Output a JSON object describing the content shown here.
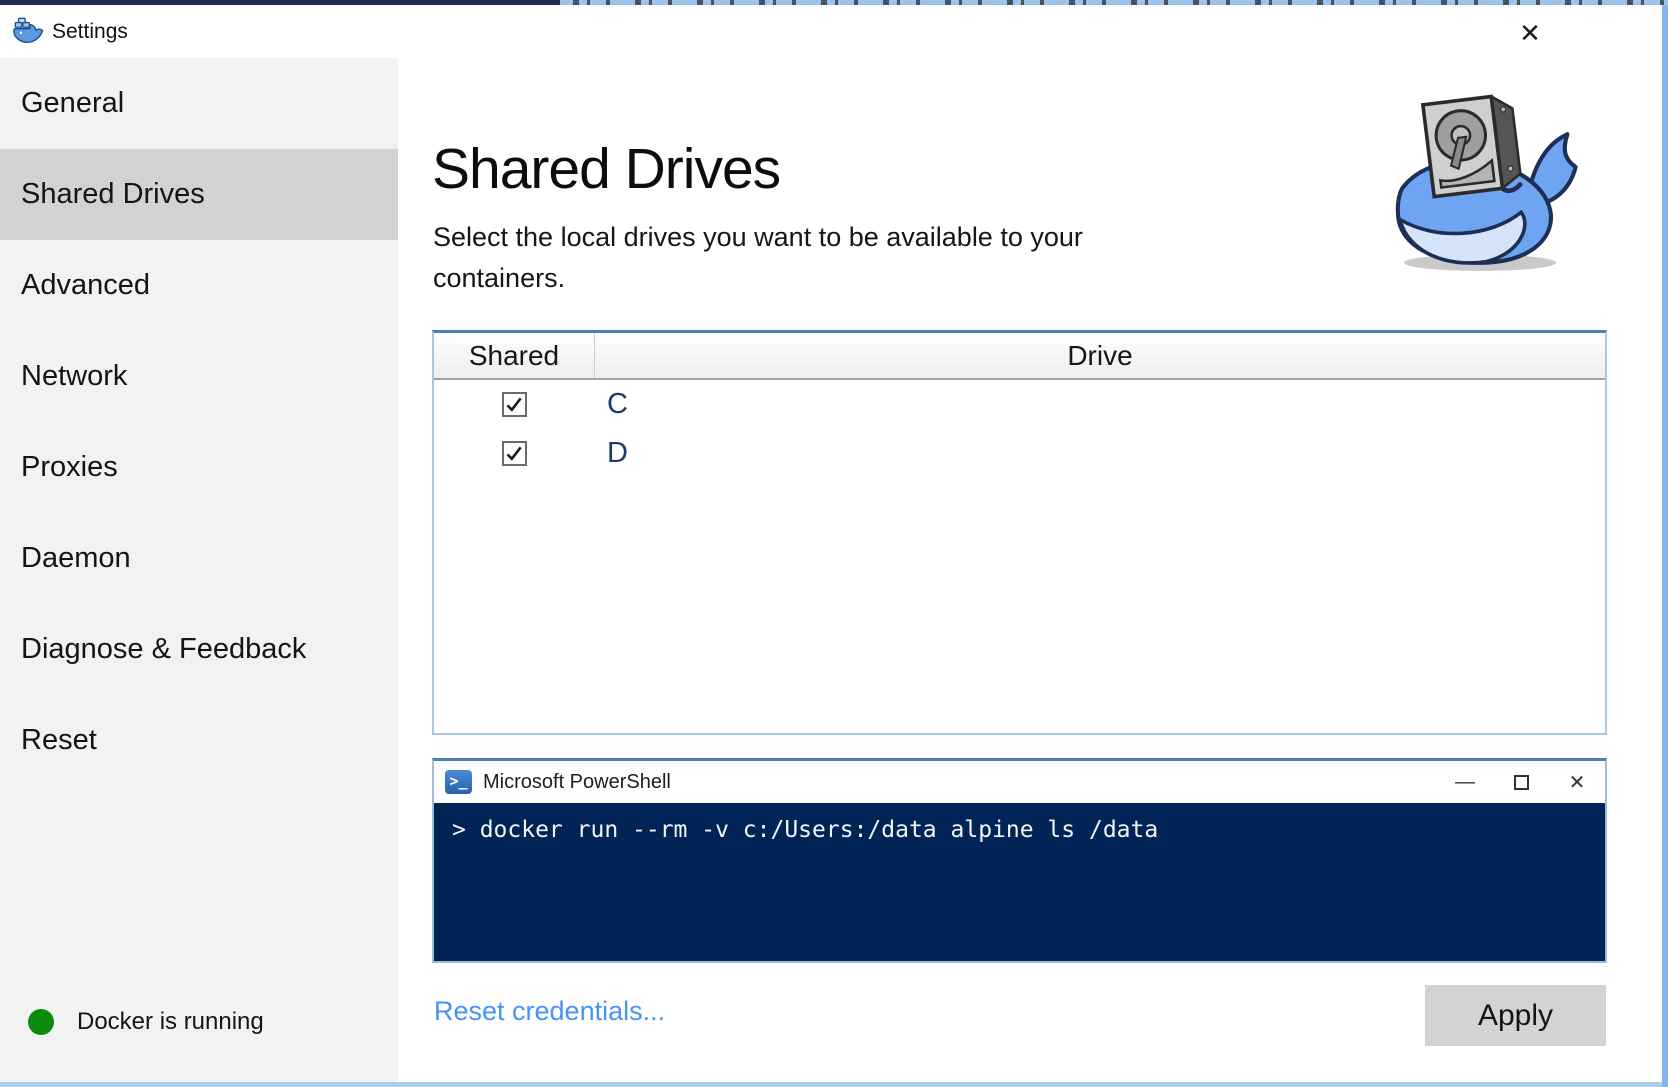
{
  "window": {
    "title": "Settings",
    "close_glyph": "✕"
  },
  "sidebar": {
    "items": [
      {
        "label": "General",
        "selected": false
      },
      {
        "label": "Shared Drives",
        "selected": true
      },
      {
        "label": "Advanced",
        "selected": false
      },
      {
        "label": "Network",
        "selected": false
      },
      {
        "label": "Proxies",
        "selected": false
      },
      {
        "label": "Daemon",
        "selected": false
      },
      {
        "label": "Diagnose & Feedback",
        "selected": false
      },
      {
        "label": "Reset",
        "selected": false
      }
    ],
    "status": {
      "text": "Docker is running",
      "dot_color": "#0c8a0c"
    }
  },
  "main": {
    "title": "Shared Drives",
    "description": "Select the local drives you want to be available to your containers.",
    "illustration": "docker-whale-carrying-hard-drive",
    "drives_table": {
      "columns": [
        "Shared",
        "Drive"
      ],
      "rows": [
        {
          "shared": true,
          "drive": "C"
        },
        {
          "shared": true,
          "drive": "D"
        }
      ]
    },
    "powershell": {
      "icon": "powershell-icon",
      "icon_glyph": ">_",
      "title": "Microsoft PowerShell",
      "controls": [
        {
          "name": "minimize",
          "glyph": "—"
        },
        {
          "name": "maximize",
          "glyph": "box"
        },
        {
          "name": "close",
          "glyph": "✕"
        }
      ],
      "command": "> docker run --rm -v c:/Users:/data alpine ls /data",
      "terminal_bg": "#012456"
    },
    "reset_credentials_label": "Reset credentials...",
    "apply_label": "Apply"
  },
  "colors": {
    "sidebar_bg": "#f2f2f2",
    "sidebar_selected": "#d2d2d2",
    "table_border": "#a9c6e2",
    "table_border_top": "#4b81b4",
    "drive_letter": "#1a3a6e",
    "link_blue": "#4494f8",
    "status_green": "#0c8a0c",
    "terminal_navy": "#012456",
    "window_border": "#86b6ea"
  }
}
